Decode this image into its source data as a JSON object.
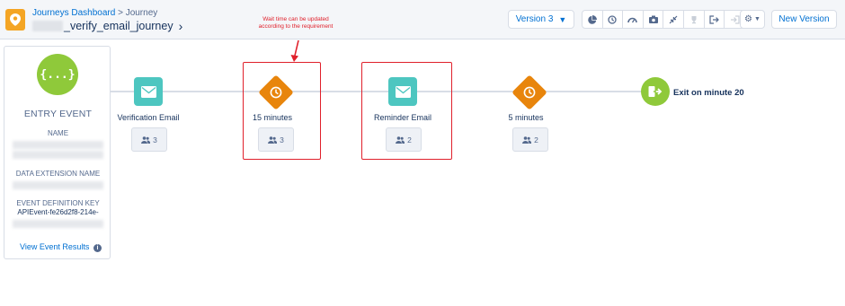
{
  "header": {
    "breadcrumb_link": "Journeys Dashboard",
    "breadcrumb_separator": ">",
    "breadcrumb_current": "Journey",
    "journey_name": "_verify_email_journey",
    "version_label": "Version 3",
    "new_version_label": "New Version"
  },
  "annotation": "Wait time can be updated according to the requirement",
  "entry": {
    "title": "ENTRY EVENT",
    "name_label": "NAME",
    "data_extension_label": "DATA EXTENSION NAME",
    "event_definition_label": "EVENT DEFINITION KEY",
    "event_definition_value": "APIEvent-fe26d2f8-214e-",
    "view_results_label": "View Event Results"
  },
  "activities": [
    {
      "type": "email",
      "label": "Verification Email",
      "count": "3"
    },
    {
      "type": "wait",
      "label": "15 minutes",
      "count": "3"
    },
    {
      "type": "email",
      "label": "Reminder Email",
      "count": "2"
    },
    {
      "type": "wait",
      "label": "5 minutes",
      "count": "2"
    }
  ],
  "exit": {
    "label": "Exit on minute 20"
  },
  "colors": {
    "email": "#4dc6c0",
    "wait": "#e8850c",
    "entry": "#8fc93a",
    "highlight": "#e0202b",
    "link": "#0070d2"
  },
  "toolbar_icons": [
    "pie-chart-icon",
    "history-icon",
    "gauge-icon",
    "camera-icon",
    "collapse-icon",
    "trophy-icon",
    "exit-icon",
    "export-icon"
  ]
}
